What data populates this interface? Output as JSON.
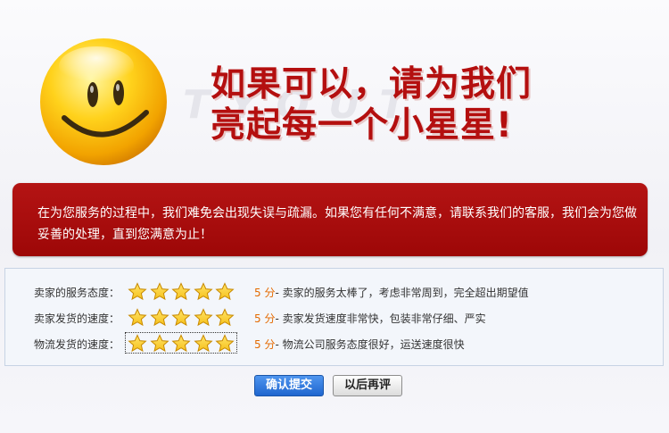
{
  "hero": {
    "headline_line1": "如果可以，请为我们",
    "headline_line2": "亮起每一个小星星!",
    "watermark": "T Y O U T"
  },
  "notice": {
    "text": "在为您服务的过程中，我们难免会出现失误与疏漏。如果您有任何不满意，请联系我们的客服，我们会为您做妥善的处理，直到您满意为止！"
  },
  "ratings": [
    {
      "label": "卖家的服务态度：",
      "stars": 5,
      "score_text": "5 分",
      "description": "- 卖家的服务太棒了，考虑非常周到，完全超出期望值"
    },
    {
      "label": "卖家发货的速度：",
      "stars": 5,
      "score_text": "5 分",
      "description": "- 卖家发货速度非常快，包装非常仔细、严实"
    },
    {
      "label": "物流发货的速度：",
      "stars": 5,
      "score_text": "5 分",
      "description": "- 物流公司服务态度很好，运送速度很快"
    }
  ],
  "buttons": {
    "confirm_label": "确认提交",
    "later_label": "以后再评"
  },
  "colors": {
    "headline": "#b40f0f",
    "notice_bg": "#a50c0c",
    "star": "#f6c01a",
    "score": "#e46a00",
    "confirm_button": "#2b74dc"
  }
}
